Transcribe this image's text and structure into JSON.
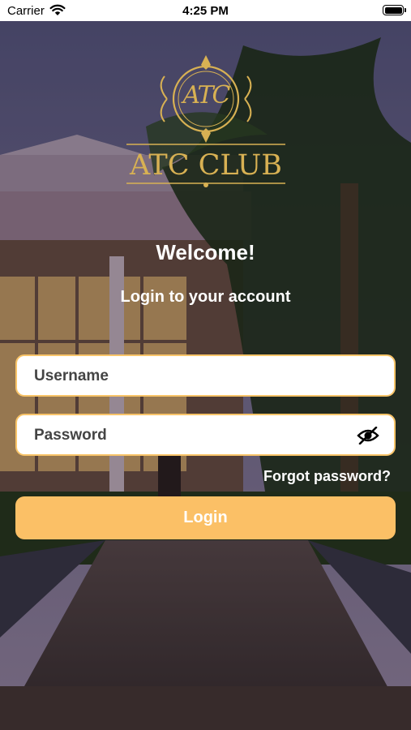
{
  "status_bar": {
    "carrier": "Carrier",
    "time": "4:25 PM"
  },
  "logo": {
    "monogram": "ATC",
    "name": "ATC CLUB"
  },
  "welcome": "Welcome!",
  "subtitle": "Login to your account",
  "form": {
    "username_placeholder": "Username",
    "password_placeholder": "Password",
    "forgot_password": "Forgot password?",
    "login_button": "Login"
  },
  "colors": {
    "accent": "#fbc066",
    "field_border": "#f8c469",
    "logo_gold": "#d8b153"
  },
  "icons": {
    "password_toggle": "eye-slash-icon",
    "wifi": "wifi-icon",
    "battery": "battery-icon"
  }
}
